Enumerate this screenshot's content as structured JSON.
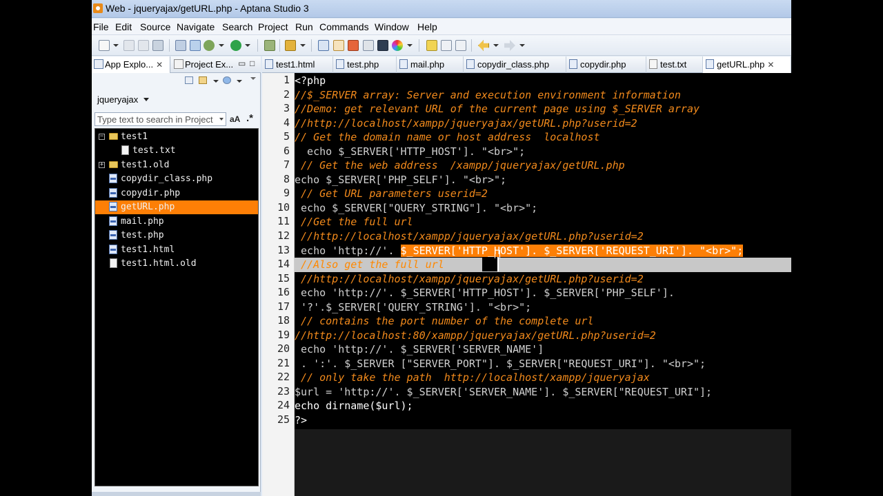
{
  "window": {
    "title": "Web - jqueryajax/getURL.php - Aptana Studio 3"
  },
  "menu": [
    "File",
    "Edit",
    "Source",
    "Navigate",
    "Search",
    "Project",
    "Run",
    "Commands",
    "Window",
    "Help"
  ],
  "left_panel": {
    "tabs": [
      {
        "label": "App Explo...",
        "active": true
      },
      {
        "label": "Project Ex...",
        "active": false
      }
    ],
    "project": "jqueryajax",
    "search_placeholder": "Type text to search in Project",
    "case_toggle": "aA",
    "regex_toggle": ".*",
    "tree": [
      {
        "label": "test1",
        "type": "folder",
        "expanded": true,
        "indent": 0
      },
      {
        "label": "test.txt",
        "type": "file",
        "indent": 1
      },
      {
        "label": "test1.old",
        "type": "folder",
        "expanded": false,
        "indent": 0
      },
      {
        "label": "copydir_class.php",
        "type": "php",
        "indent": 0
      },
      {
        "label": "copydir.php",
        "type": "php",
        "indent": 0
      },
      {
        "label": "getURL.php",
        "type": "php",
        "indent": 0,
        "selected": true
      },
      {
        "label": "mail.php",
        "type": "php",
        "indent": 0
      },
      {
        "label": "test.php",
        "type": "php",
        "indent": 0
      },
      {
        "label": "test1.html",
        "type": "php",
        "indent": 0
      },
      {
        "label": "test1.html.old",
        "type": "file",
        "indent": 0
      }
    ]
  },
  "editor": {
    "tabs": [
      {
        "label": "test1.html",
        "active": false
      },
      {
        "label": "test.php",
        "active": false
      },
      {
        "label": "mail.php",
        "active": false
      },
      {
        "label": "copydir_class.php",
        "active": false
      },
      {
        "label": "copydir.php",
        "active": false
      },
      {
        "label": "test.txt",
        "active": false
      },
      {
        "label": "getURL.php",
        "active": true
      }
    ],
    "line_numbers": [
      "1",
      "2",
      "3",
      "4",
      "5",
      "6",
      "7",
      "8",
      "9",
      "10",
      "11",
      "12",
      "13",
      "14",
      "15",
      "16",
      "17",
      "18",
      "19",
      "20",
      "21",
      "22",
      "23",
      "24",
      "25"
    ],
    "lines": {
      "l1": "<?php",
      "l2": "//$_SERVER array: Server and execution environment information",
      "l3": "//Demo: get relevant URL of the current page using $_SERVER array",
      "l4": "//http://localhost/xampp/jqueryajax/getURL.php?userid=2",
      "l5": "// Get the domain name or host address  localhost",
      "l6a": "  echo $_SERVER['HTTP_HOST']. \"<br>\";",
      "l7": " // Get the web address  /xampp/jqueryajax/getURL.php",
      "l8": "echo $_SERVER['PHP_SELF']. \"<br>\";",
      "l9": " // Get URL parameters userid=2",
      "l10": " echo $_SERVER[\"QUERY_STRING\"]. \"<br>\";",
      "l11": " //Get the full url",
      "l12": " //http://localhost/xampp/jqueryajax/getURL.php?userid=2",
      "l13a": " echo 'http://'. ",
      "l13b": "$_SERVER['HTTP_HOST']. $_SERVER['REQUEST_URI']. \"<br>\";",
      "l14": " //Also get the full url",
      "l15": " //http://localhost/xampp/jqueryajax/getURL.php?userid=2",
      "l16": " echo 'http://'. $_SERVER['HTTP_HOST']. $_SERVER['PHP_SELF'].",
      "l17": " '?'.$_SERVER['QUERY_STRING']. \"<br>\";",
      "l18": " // contains the port number of the complete url",
      "l19": "//http://localhost:80/xampp/jqueryajax/getURL.php?userid=2",
      "l20": " echo 'http://'. $_SERVER['SERVER_NAME']",
      "l21": " . ':'. $_SERVER [\"SERVER_PORT\"]. $_SERVER[\"REQUEST_URI\"]. \"<br>\";",
      "l22": " // only take the path  http://localhost/xampp/jqueryajax",
      "l23": "$url = 'http://'. $_SERVER['SERVER_NAME']. $_SERVER[\"REQUEST_URI\"];",
      "l24": "echo dirname($url);",
      "l25": "?>"
    }
  },
  "colors": {
    "comment": "#f28a1c",
    "selection": "#fd7f06",
    "background": "#000000"
  }
}
